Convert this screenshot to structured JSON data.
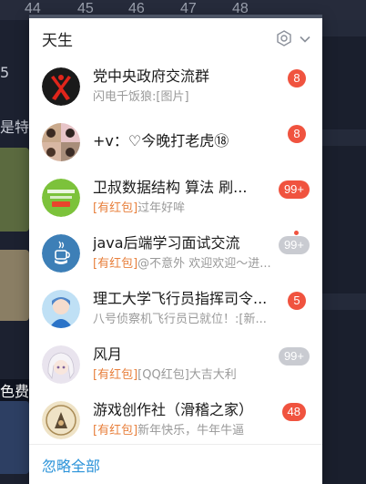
{
  "background": {
    "numbers": [
      "44",
      "45",
      "46",
      "47",
      "48"
    ],
    "left_snippets": [
      "5",
      "是特",
      "色费"
    ]
  },
  "popup": {
    "title": "天生",
    "settings_icon": "hexagon-settings-icon",
    "dropdown_icon": "chevron-down-icon",
    "ignore_all": "忽略全部"
  },
  "conversations": [
    {
      "name": "党中央政府交流群",
      "tag": "",
      "message": "闪电千饭狼:[图片]",
      "badge": "8",
      "badge_style": "red",
      "avatar": "red-x-logo"
    },
    {
      "name": "+v：♡今晚打老虎⑱",
      "tag": "",
      "message": "",
      "badge": "8",
      "badge_style": "red",
      "avatar": "photo-collage"
    },
    {
      "name": "卫叔数据结构 算法  刷...",
      "tag": "[有红包]",
      "message": "过年好哞",
      "badge": "99+",
      "badge_style": "red",
      "avatar": "green-promo"
    },
    {
      "name": "java后端学习面试交流",
      "tag": "[有红包]",
      "message": "@不意外 欢迎欢迎～进...",
      "badge": "99+",
      "badge_style": "grey",
      "avatar": "java-logo",
      "dot": true
    },
    {
      "name": "理工大学飞行员指挥司令...",
      "tag": "",
      "message": "八号侦察机飞行员已就位！:[新...",
      "badge": "5",
      "badge_style": "red",
      "avatar": "anime-blue"
    },
    {
      "name": "风月",
      "tag": "[有红包]",
      "message": "[QQ红包]大吉大利",
      "badge": "99+",
      "badge_style": "grey",
      "avatar": "anime-white"
    },
    {
      "name": "游戏创作社（滑稽之家）",
      "tag": "[有红包]",
      "message": "新年快乐，牛年牛逼",
      "badge": "48",
      "badge_style": "red",
      "avatar": "game-circle"
    }
  ]
}
